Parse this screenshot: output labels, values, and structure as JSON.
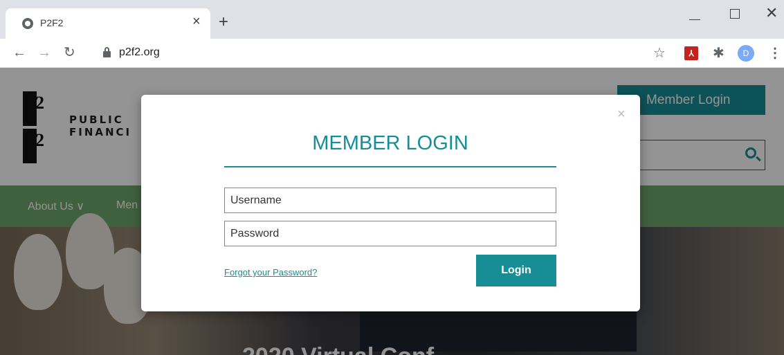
{
  "browser": {
    "tab_title": "P2F2",
    "url": "p2f2.org",
    "avatar_letter": "D"
  },
  "site": {
    "logo_top_number": "2",
    "logo_bottom_number": "2",
    "logo_line1": "PUBLIC",
    "logo_line2": "FINANCI",
    "member_login_label": "Member Login",
    "nav": [
      {
        "label": "About Us ∨"
      },
      {
        "label": "Men"
      }
    ],
    "hero_title": "2020 Virtual Conf"
  },
  "modal": {
    "close_glyph": "×",
    "title": "MEMBER LOGIN",
    "username_placeholder": "Username",
    "password_placeholder": "Password",
    "forgot_label": "Forgot your Password?",
    "login_label": "Login"
  },
  "colors": {
    "accent": "#178e96",
    "nav_green": "#6fa86a"
  }
}
